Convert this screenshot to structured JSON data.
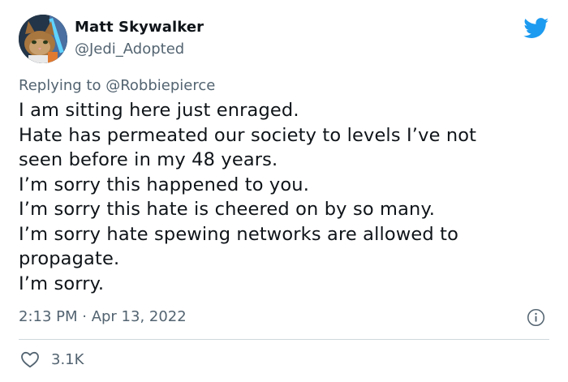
{
  "author": {
    "display_name": "Matt Skywalker",
    "handle": "@Jedi_Adopted",
    "avatar_icon": "cat-avatar"
  },
  "brand": {
    "icon": "twitter-bird-icon",
    "color": "#1d9bf0"
  },
  "reply": {
    "prefix": "Replying to",
    "mention": "@Robbiepierce"
  },
  "body": {
    "lines": [
      "I am sitting here just enraged.",
      "Hate has permeated our society to levels I’ve not",
      "seen before in my 48 years.",
      "I’m sorry this happened to you.",
      "I’m sorry this hate is cheered on by so many.",
      "I’m sorry hate spewing networks are allowed to",
      "propagate.",
      "I’m sorry."
    ]
  },
  "meta": {
    "timestamp": "2:13 PM · Apr 13, 2022",
    "info_icon": "info-icon"
  },
  "engagement": {
    "like_icon": "heart-icon",
    "like_count": "3.1K"
  },
  "colors": {
    "text_primary": "#0f1419",
    "text_secondary": "#536471",
    "divider": "#cfd9de"
  }
}
